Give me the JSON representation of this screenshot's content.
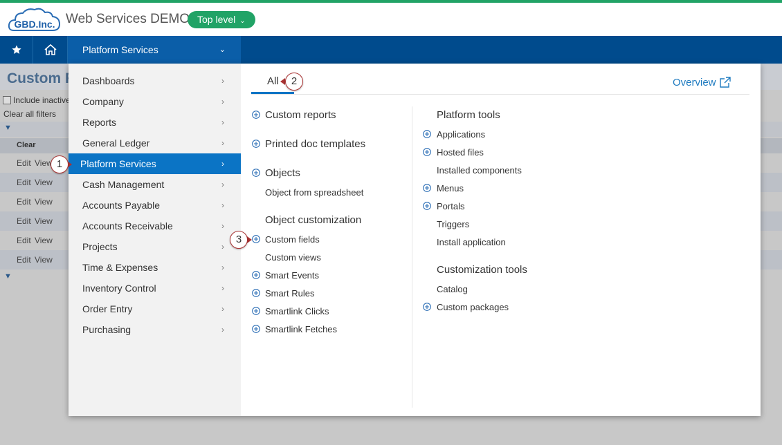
{
  "header": {
    "logo_text": "GBD.Inc.",
    "app_title": "Web Services DEMO",
    "level_button": "Top level"
  },
  "navbar": {
    "star_icon": "star-icon",
    "home_icon": "home-icon",
    "menu_label": "Platform Services"
  },
  "background_page": {
    "title": "Custom Fi",
    "include_inactive": "Include inactive",
    "clear_all_filters": "Clear all filters",
    "clear_header": "Clear",
    "rows": [
      {
        "edit": "Edit",
        "view": "View"
      },
      {
        "edit": "Edit",
        "view": "View"
      },
      {
        "edit": "Edit",
        "view": "View"
      },
      {
        "edit": "Edit",
        "view": "View"
      },
      {
        "edit": "Edit",
        "view": "View"
      },
      {
        "edit": "Edit",
        "view": "View"
      }
    ]
  },
  "menu": {
    "categories": [
      {
        "label": "Dashboards"
      },
      {
        "label": "Company"
      },
      {
        "label": "Reports"
      },
      {
        "label": "General Ledger"
      },
      {
        "label": "Platform Services"
      },
      {
        "label": "Cash Management"
      },
      {
        "label": "Accounts Payable"
      },
      {
        "label": "Accounts Receivable"
      },
      {
        "label": "Projects"
      },
      {
        "label": "Time & Expenses"
      },
      {
        "label": "Inventory Control"
      },
      {
        "label": "Order Entry"
      },
      {
        "label": "Purchasing"
      }
    ],
    "active_category": "Platform Services",
    "tab_all": "All",
    "overview": "Overview",
    "left_column": {
      "custom_reports": "Custom reports",
      "printed_doc_templates": "Printed doc templates",
      "objects": "Objects",
      "object_from_spreadsheet": "Object from spreadsheet",
      "object_customization": "Object customization",
      "custom_fields": "Custom fields",
      "custom_views": "Custom views",
      "smart_events": "Smart Events",
      "smart_rules": "Smart Rules",
      "smartlink_clicks": "Smartlink Clicks",
      "smartlink_fetches": "Smartlink Fetches"
    },
    "right_column": {
      "platform_tools": "Platform tools",
      "applications": "Applications",
      "hosted_files": "Hosted files",
      "installed_components": "Installed components",
      "menus": "Menus",
      "portals": "Portals",
      "triggers": "Triggers",
      "install_application": "Install application",
      "customization_tools": "Customization tools",
      "catalog": "Catalog",
      "custom_packages": "Custom packages"
    }
  },
  "badges": {
    "one": "1",
    "two": "2",
    "three": "3"
  },
  "colors": {
    "accent_green": "#21a366",
    "nav_blue": "#004b8d",
    "active_blue": "#0b74c5",
    "link_blue": "#1f7bc0"
  }
}
